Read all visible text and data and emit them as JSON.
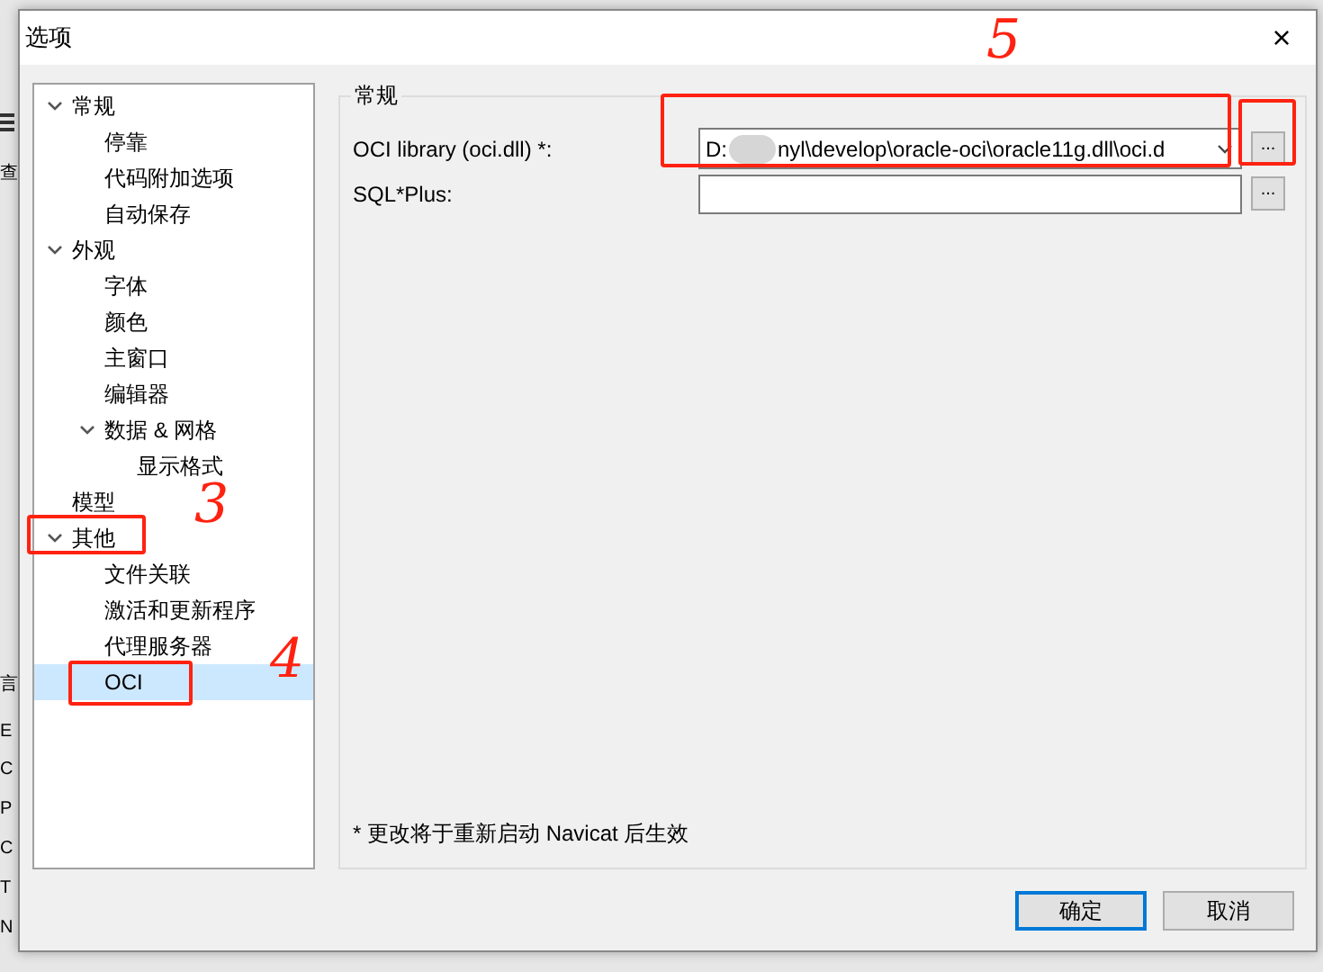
{
  "background_app": {
    "edge_texts": [
      "查",
      "言",
      "E",
      "C",
      "P",
      "C",
      "T",
      "N"
    ]
  },
  "window": {
    "title": "选项",
    "close": "×"
  },
  "tree": [
    {
      "label": "常规",
      "expanded": true,
      "selected": false,
      "children": [
        {
          "label": "停靠",
          "selected": false
        },
        {
          "label": "代码附加选项",
          "selected": false
        },
        {
          "label": "自动保存",
          "selected": false
        }
      ]
    },
    {
      "label": "外观",
      "expanded": true,
      "selected": false,
      "children": [
        {
          "label": "字体",
          "selected": false
        },
        {
          "label": "颜色",
          "selected": false
        },
        {
          "label": "主窗口",
          "selected": false
        },
        {
          "label": "编辑器",
          "selected": false
        },
        {
          "label": "数据 & 网格",
          "expanded": true,
          "selected": false,
          "children": [
            {
              "label": "显示格式",
              "selected": false
            }
          ]
        }
      ]
    },
    {
      "label": "模型",
      "selected": false
    },
    {
      "label": "其他",
      "expanded": true,
      "selected": false,
      "children": [
        {
          "label": "文件关联",
          "selected": false
        },
        {
          "label": "激活和更新程序",
          "selected": false
        },
        {
          "label": "代理服务器",
          "selected": false
        },
        {
          "label": "OCI",
          "selected": true
        }
      ]
    }
  ],
  "group": {
    "title": "常规",
    "fields": [
      {
        "label": "OCI library (oci.dll) *:",
        "kind": "combo",
        "value_start": "D:",
        "value_end": "nyl\\develop\\oracle-oci\\oracle11g.dll\\oci.d",
        "browse": "..."
      },
      {
        "label": "SQL*Plus:",
        "kind": "text",
        "browse": "..."
      }
    ],
    "note": "* 更改将于重新启动 Navicat 后生效"
  },
  "buttons": [
    {
      "label": "确定",
      "default": true
    },
    {
      "label": "取消",
      "default": false
    }
  ],
  "annotations": [
    {
      "kind": "box"
    },
    {
      "kind": "box"
    },
    {
      "kind": "box"
    },
    {
      "kind": "box"
    },
    {
      "kind": "number",
      "label": "5"
    },
    {
      "kind": "number",
      "label": "3"
    },
    {
      "kind": "number",
      "label": "4"
    }
  ]
}
